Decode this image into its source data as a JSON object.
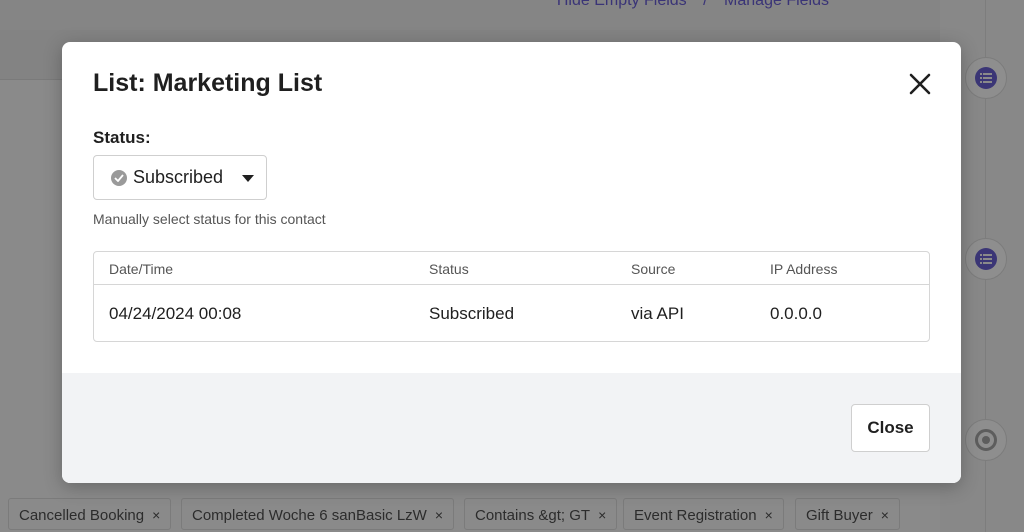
{
  "background": {
    "top_links": [
      "Hide Empty Fields",
      "/",
      "Manage Fields"
    ],
    "tags": [
      {
        "label": "Cancelled Booking"
      },
      {
        "label": "Completed Woche 6 sanBasic LzW"
      },
      {
        "label": "Contains &gt; GT"
      },
      {
        "label": "Event Registration"
      },
      {
        "label": "Gift Buyer"
      }
    ],
    "tag_remove_glyph": "×"
  },
  "modal": {
    "title": "List: Marketing List",
    "close_icon": "close-icon",
    "status_label": "Status:",
    "status_select": {
      "value": "Subscribed",
      "icon": "check-circle-icon"
    },
    "helper_text": "Manually select status for this contact",
    "history": {
      "columns": [
        "Date/Time",
        "Status",
        "Source",
        "IP Address"
      ],
      "rows": [
        [
          "04/24/2024 00:08",
          "Subscribed",
          "via API",
          "0.0.0.0"
        ]
      ]
    },
    "footer": {
      "close_label": "Close"
    }
  },
  "colors": {
    "accent": "#3b3676",
    "overlay": "#8a8a8a",
    "modal_bg": "#ffffff",
    "footer_bg": "#f2f3f5"
  }
}
